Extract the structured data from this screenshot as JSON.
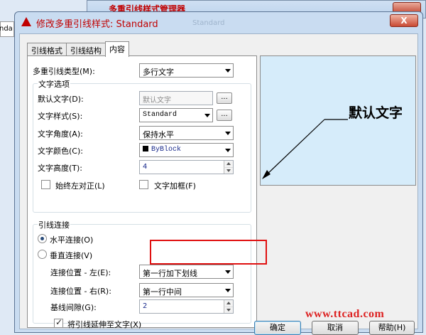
{
  "background_window": {
    "title": "多重引线样式管理器"
  },
  "left_strip": {
    "text": "nda"
  },
  "dialog": {
    "title": "修改多重引线样式: Standard",
    "ghost_title": "Standard",
    "close_label": "X"
  },
  "tabs": [
    {
      "label": "引线格式"
    },
    {
      "label": "引线结构"
    },
    {
      "label": "内容"
    }
  ],
  "content": {
    "mleader_type_label": "多重引线类型(M):",
    "mleader_type_value": "多行文字",
    "text_options": {
      "group_label": "文字选项",
      "default_text_label": "默认文字(D):",
      "default_text_value": "默认文字",
      "default_text_button": "...",
      "text_style_label": "文字样式(S):",
      "text_style_value": "Standard",
      "text_style_button": "...",
      "text_angle_label": "文字角度(A):",
      "text_angle_value": "保持水平",
      "text_color_label": "文字颜色(C):",
      "text_color_value": "ByBlock",
      "text_height_label": "文字高度(T):",
      "text_height_value": "4",
      "always_left_label": "始终左对正(L)",
      "always_left_checked": false,
      "text_frame_label": "文字加框(F)",
      "text_frame_checked": false
    },
    "leader_connection": {
      "group_label": "引线连接",
      "horizontal_label": "水平连接(O)",
      "horizontal_selected": true,
      "vertical_label": "垂直连接(V)",
      "vertical_selected": false,
      "attach_left_label": "连接位置 - 左(E):",
      "attach_left_value": "第一行加下划线",
      "attach_right_label": "连接位置 - 右(R):",
      "attach_right_value": "第一行中间",
      "landing_gap_label": "基线间隙(G):",
      "landing_gap_value": "2",
      "extend_leader_label": "将引线延伸至文字(X)",
      "extend_leader_checked": true
    }
  },
  "preview": {
    "text": "默认文字"
  },
  "buttons": {
    "ok": "确定",
    "cancel": "取消",
    "help": "帮助(H)"
  },
  "watermark": "www.ttcad.com",
  "colors": {
    "title_red": "#c00000",
    "preview_bg": "#d6ecfa",
    "highlight_red": "#e01010",
    "window_frame": "#c9dcf1"
  }
}
